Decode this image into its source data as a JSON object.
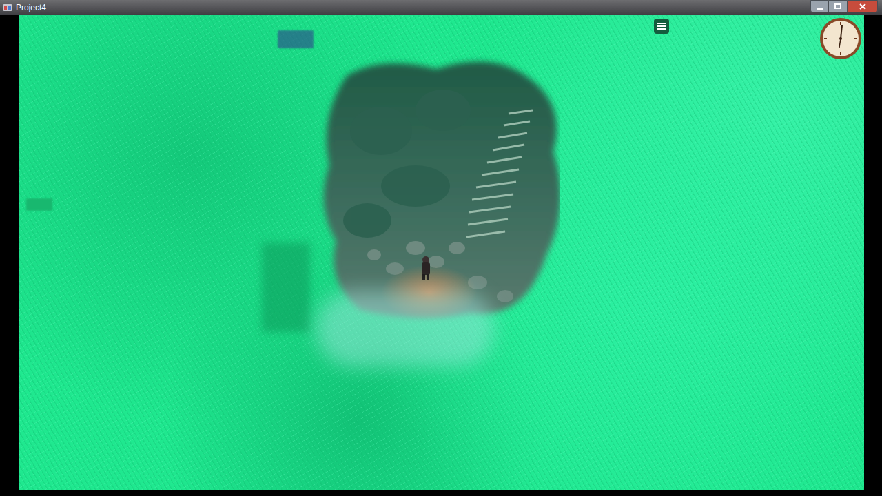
{
  "window": {
    "title": "Project4"
  }
}
